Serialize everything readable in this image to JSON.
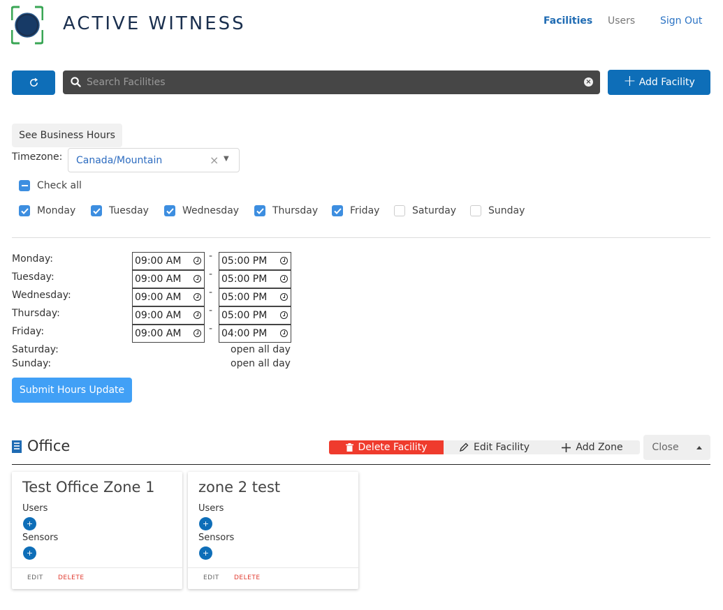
{
  "header": {
    "brand": "ACTIVE WITNESS",
    "nav": {
      "facilities": "Facilities",
      "users": "Users",
      "sign_out": "Sign Out"
    }
  },
  "toolbar": {
    "search_placeholder": "Search Facilities",
    "add_facility_label": "Add Facility"
  },
  "business_hours": {
    "see_hours_label": "See Business Hours",
    "timezone_label": "Timezone:",
    "timezone_value": "Canada/Mountain",
    "check_all_label": "Check all",
    "days": [
      {
        "label": "Monday",
        "checked": true
      },
      {
        "label": "Tuesday",
        "checked": true
      },
      {
        "label": "Wednesday",
        "checked": true
      },
      {
        "label": "Thursday",
        "checked": true
      },
      {
        "label": "Friday",
        "checked": true
      },
      {
        "label": "Saturday",
        "checked": false
      },
      {
        "label": "Sunday",
        "checked": false
      }
    ],
    "schedule": [
      {
        "day": "Monday:",
        "start": "09:00 AM",
        "end": "05:00 PM"
      },
      {
        "day": "Tuesday:",
        "start": "09:00 AM",
        "end": "05:00 PM"
      },
      {
        "day": "Wednesday:",
        "start": "09:00 AM",
        "end": "05:00 PM"
      },
      {
        "day": "Thursday:",
        "start": "09:00 AM",
        "end": "05:00 PM"
      },
      {
        "day": "Friday:",
        "start": "09:00 AM",
        "end": "04:00 PM"
      },
      {
        "day": "Saturday:",
        "status": "open all day"
      },
      {
        "day": "Sunday:",
        "status": "open all day"
      }
    ],
    "separator": "-",
    "submit_label": "Submit Hours Update"
  },
  "facility": {
    "name": "Office",
    "delete_label": "Delete Facility",
    "edit_label": "Edit Facility",
    "add_zone_label": "Add Zone",
    "close_label": "Close",
    "zones": [
      {
        "title": "Test Office Zone 1",
        "users_label": "Users",
        "sensors_label": "Sensors",
        "add_symbol": "+",
        "edit_label": "EDIT",
        "delete_label": "DELETE"
      },
      {
        "title": "zone 2 test",
        "users_label": "Users",
        "sensors_label": "Sensors",
        "add_symbol": "+",
        "edit_label": "EDIT",
        "delete_label": "DELETE"
      }
    ]
  },
  "colors": {
    "primary": "#0e6eb8",
    "submit": "#41a0f6",
    "danger": "#ef3b2d",
    "search_bg": "#464646",
    "brand_green": "#3aa655",
    "brand_navy": "#1a2f4e"
  }
}
